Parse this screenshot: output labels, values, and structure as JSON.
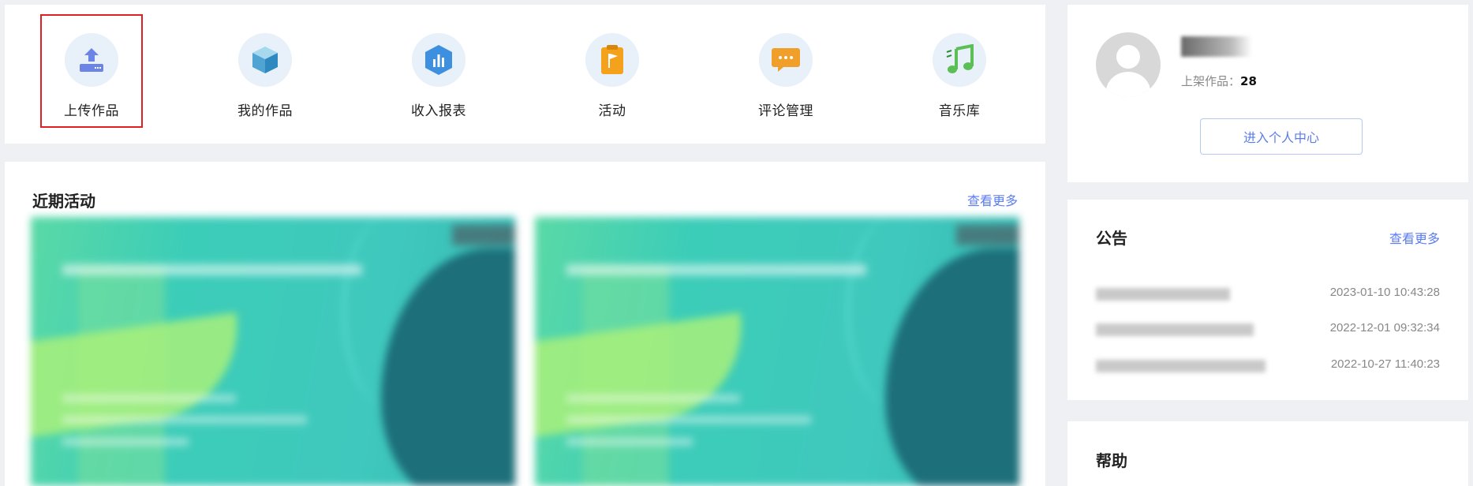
{
  "quick_actions": [
    {
      "id": "upload",
      "label": "上传作品",
      "icon": "upload-icon",
      "selected": true
    },
    {
      "id": "my-works",
      "label": "我的作品",
      "icon": "cube-icon",
      "selected": false
    },
    {
      "id": "income",
      "label": "收入报表",
      "icon": "bar-chart-icon",
      "selected": false
    },
    {
      "id": "activity",
      "label": "活动",
      "icon": "flag-icon",
      "selected": false
    },
    {
      "id": "comments",
      "label": "评论管理",
      "icon": "chat-icon",
      "selected": false
    },
    {
      "id": "music",
      "label": "音乐库",
      "icon": "music-note-icon",
      "selected": false
    }
  ],
  "activities": {
    "title": "近期活动",
    "more": "查看更多"
  },
  "profile": {
    "works_label": "上架作品：",
    "works_count": "28",
    "center_button": "进入个人中心"
  },
  "notices": {
    "title": "公告",
    "more": "查看更多",
    "items": [
      {
        "time": "2023-01-10 10:43:28"
      },
      {
        "time": "2022-12-01 09:32:34"
      },
      {
        "time": "2022-10-27 11:40:23"
      }
    ]
  },
  "help": {
    "title": "帮助"
  },
  "colors": {
    "accent": "#5b7cf0",
    "selection_outline": "#e02020",
    "page_bg": "#eff0f4"
  }
}
